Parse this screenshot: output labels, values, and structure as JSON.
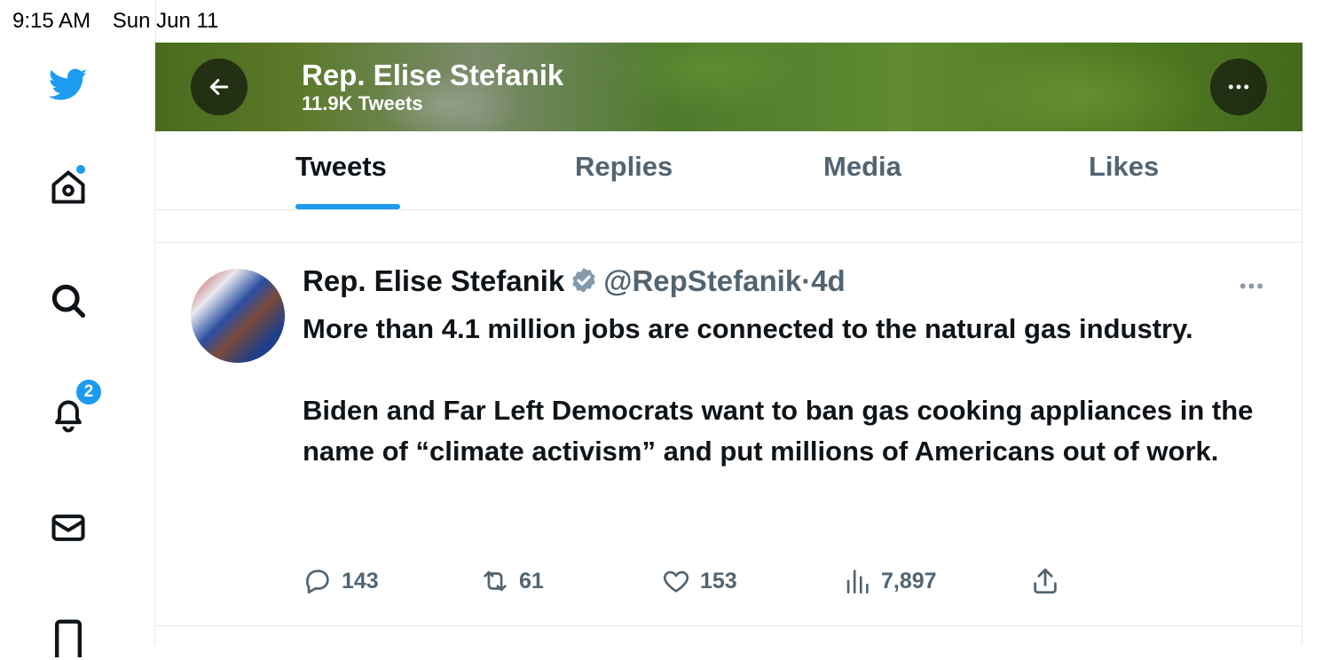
{
  "status_bar": {
    "time": "9:15 AM",
    "date": "Sun Jun 11"
  },
  "sidebar": {
    "items": [
      {
        "name": "twitter-logo"
      },
      {
        "name": "home",
        "has_dot": true
      },
      {
        "name": "search"
      },
      {
        "name": "notifications",
        "badge": "2"
      },
      {
        "name": "messages"
      },
      {
        "name": "bookmarks"
      }
    ]
  },
  "header": {
    "title": "Rep. Elise Stefanik",
    "subtitle": "11.9K Tweets"
  },
  "tabs": [
    {
      "label": "Tweets",
      "active": true
    },
    {
      "label": "Replies",
      "active": false
    },
    {
      "label": "Media",
      "active": false
    },
    {
      "label": "Likes",
      "active": false
    }
  ],
  "tweet": {
    "name": "Rep. Elise Stefanik",
    "handle": "@RepStefanik",
    "separator": "·",
    "time": "4d",
    "more": "•••",
    "body": [
      "More than 4.1 million jobs are connected to the natural gas industry.",
      "Biden and Far Left Democrats want to ban gas cooking appliances in the name of “climate activism” and put millions of Americans out of work."
    ],
    "stats": {
      "replies": "143",
      "retweets": "61",
      "likes": "153",
      "views": "7,897"
    }
  },
  "colors": {
    "accent": "#1d9bf0",
    "text": "#0f1419",
    "muted": "#536471",
    "banner": "#4f7a22"
  }
}
